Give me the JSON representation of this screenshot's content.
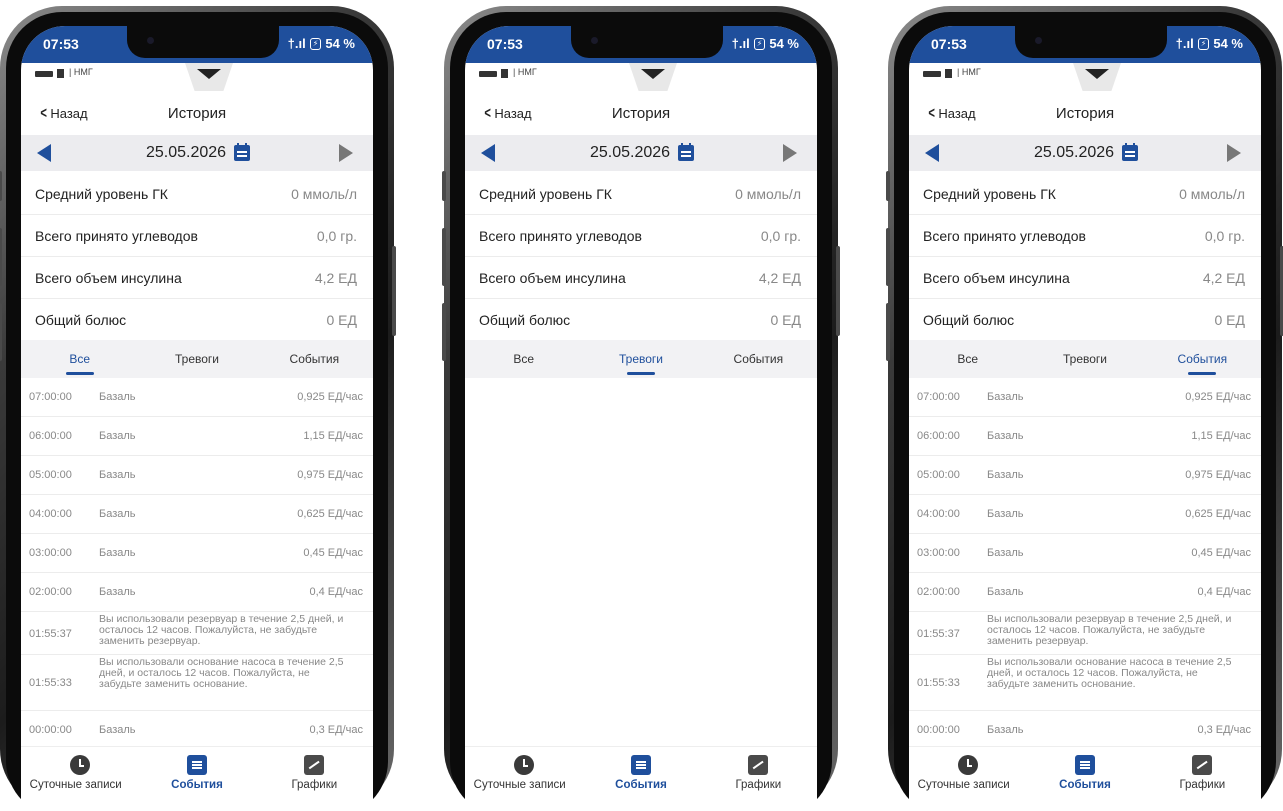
{
  "status_bar": {
    "time": "07:53",
    "battery": "54 %"
  },
  "device_bar": {
    "label": "НМГ"
  },
  "nav": {
    "back_label": "Назад",
    "title": "История"
  },
  "date": {
    "value": "25.05.2026"
  },
  "summary": [
    {
      "label": "Средний уровень ГК",
      "value": "0 ммоль/л"
    },
    {
      "label": "Всего принято углеводов",
      "value": "0,0 гр."
    },
    {
      "label": "Всего объем инсулина",
      "value": "4,2 ЕД"
    },
    {
      "label": "Общий болюс",
      "value": "0 ЕД"
    }
  ],
  "tabs": [
    "Все",
    "Тревоги",
    "События"
  ],
  "events": [
    {
      "time": "07:00:00",
      "name": "Базаль",
      "value": "0,925 ЕД/час"
    },
    {
      "time": "06:00:00",
      "name": "Базаль",
      "value": "1,15 ЕД/час"
    },
    {
      "time": "05:00:00",
      "name": "Базаль",
      "value": "0,975 ЕД/час"
    },
    {
      "time": "04:00:00",
      "name": "Базаль",
      "value": "0,625 ЕД/час"
    },
    {
      "time": "03:00:00",
      "name": "Базаль",
      "value": "0,45 ЕД/час"
    },
    {
      "time": "02:00:00",
      "name": "Базаль",
      "value": "0,4 ЕД/час"
    },
    {
      "time": "01:55:37",
      "message": "Вы использовали резервуар в течение 2,5 дней, и осталось 12 часов. Пожалуйста, не забудьте заменить резервуар."
    },
    {
      "time": "01:55:33",
      "message": "Вы использовали основание насоса в течение 2,5 дней, и осталось 12 часов. Пожалуйста, не забудьте заменить основание."
    },
    {
      "time": "00:00:00",
      "name": "Базаль",
      "value": "0,3 ЕД/час"
    }
  ],
  "bottom_nav": [
    "Суточные записи",
    "События",
    "Графики"
  ],
  "screens": [
    {
      "active_tab": 0,
      "show_events": true
    },
    {
      "active_tab": 1,
      "show_events": false
    },
    {
      "active_tab": 2,
      "show_events": true
    }
  ],
  "colors": {
    "accent": "#1f4f9c",
    "status_bar": "#1f4f9c",
    "tab_bg": "#f2f2f4"
  }
}
